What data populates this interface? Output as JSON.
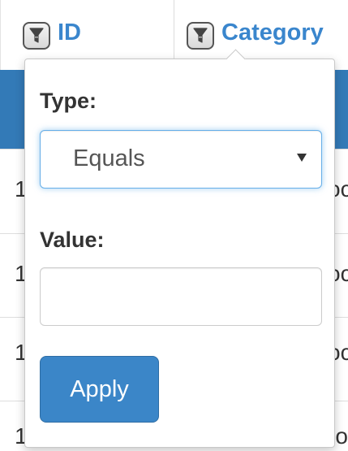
{
  "header": {
    "columns": [
      {
        "label": "ID"
      },
      {
        "label": "Category"
      }
    ]
  },
  "filter_popup": {
    "type_label": "Type:",
    "type_selected": "Equals",
    "value_label": "Value:",
    "value_input": "",
    "value_placeholder": "",
    "apply_label": "Apply"
  },
  "table": {
    "rows": [
      {
        "id": "1",
        "category": "oc"
      },
      {
        "id": "1",
        "category": "oc"
      },
      {
        "id": "1",
        "category": "oc"
      },
      {
        "id": "1",
        "category": "ro"
      }
    ]
  },
  "icons": {
    "header_filter": "filter-funnel-icon",
    "select_caret": "caret-down-icon"
  },
  "colors": {
    "header_link": "#3a86cd",
    "selected_row": "#337ab7",
    "apply_button": "#3b86c8",
    "focus_ring": "#66afe9"
  }
}
